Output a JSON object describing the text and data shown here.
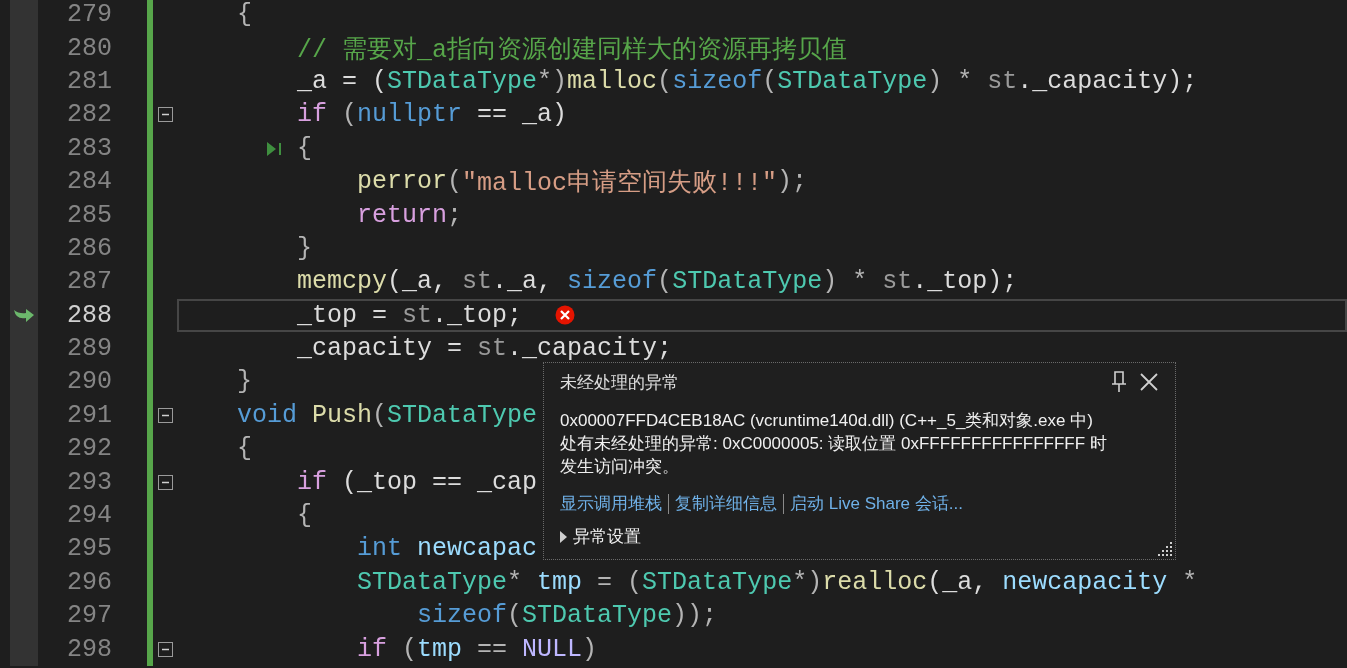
{
  "editor": {
    "lines": [
      {
        "number": "279",
        "tokens": [
          {
            "text": "    {",
            "kind": "punct"
          }
        ]
      },
      {
        "number": "280",
        "tokens": [
          {
            "text": "        // 需要对_a指向资源创建同样大的资源再拷贝值",
            "kind": "comment"
          }
        ]
      },
      {
        "number": "281",
        "tokens": [
          {
            "text": "        _a = (",
            "kind": "plain"
          },
          {
            "text": "STDataType",
            "kind": "type"
          },
          {
            "text": "*)",
            "kind": "punct"
          },
          {
            "text": "malloc",
            "kind": "function"
          },
          {
            "text": "(",
            "kind": "punct"
          },
          {
            "text": "sizeof",
            "kind": "keyword"
          },
          {
            "text": "(",
            "kind": "punct"
          },
          {
            "text": "STDataType",
            "kind": "type"
          },
          {
            "text": ") * ",
            "kind": "punct"
          },
          {
            "text": "st",
            "kind": "param"
          },
          {
            "text": "._capacity);",
            "kind": "plain"
          }
        ]
      },
      {
        "number": "282",
        "fold": true,
        "tokens": [
          {
            "text": "        if",
            "kind": "control"
          },
          {
            "text": " (",
            "kind": "punct"
          },
          {
            "text": "nullptr",
            "kind": "keyword"
          },
          {
            "text": " == _a)",
            "kind": "plain"
          }
        ]
      },
      {
        "number": "283",
        "run_to_cursor": true,
        "tokens": [
          {
            "text": "        {",
            "kind": "punct"
          }
        ]
      },
      {
        "number": "284",
        "tokens": [
          {
            "text": "            perror",
            "kind": "function"
          },
          {
            "text": "(",
            "kind": "punct"
          },
          {
            "text": "\"malloc申请空间失败!!!\"",
            "kind": "string"
          },
          {
            "text": ");",
            "kind": "punct"
          }
        ]
      },
      {
        "number": "285",
        "tokens": [
          {
            "text": "            return",
            "kind": "control"
          },
          {
            "text": ";",
            "kind": "punct"
          }
        ]
      },
      {
        "number": "286",
        "tokens": [
          {
            "text": "        }",
            "kind": "punct"
          }
        ]
      },
      {
        "number": "287",
        "tokens": [
          {
            "text": "        memcpy",
            "kind": "function"
          },
          {
            "text": "(_a, ",
            "kind": "plain"
          },
          {
            "text": "st",
            "kind": "param"
          },
          {
            "text": "._a, ",
            "kind": "plain"
          },
          {
            "text": "sizeof",
            "kind": "keyword"
          },
          {
            "text": "(",
            "kind": "punct"
          },
          {
            "text": "STDataType",
            "kind": "type"
          },
          {
            "text": ") * ",
            "kind": "punct"
          },
          {
            "text": "st",
            "kind": "param"
          },
          {
            "text": "._top);",
            "kind": "plain"
          }
        ]
      },
      {
        "number": "288",
        "current": true,
        "error": true,
        "tokens": [
          {
            "text": "        _top = ",
            "kind": "plain"
          },
          {
            "text": "st",
            "kind": "param"
          },
          {
            "text": "._top;",
            "kind": "plain"
          }
        ]
      },
      {
        "number": "289",
        "tokens": [
          {
            "text": "        _capacity = ",
            "kind": "plain"
          },
          {
            "text": "st",
            "kind": "param"
          },
          {
            "text": "._capacity;",
            "kind": "plain"
          }
        ]
      },
      {
        "number": "290",
        "tokens": [
          {
            "text": "    }",
            "kind": "punct"
          }
        ]
      },
      {
        "number": "291",
        "fold": true,
        "tokens": [
          {
            "text": "    void ",
            "kind": "keyword"
          },
          {
            "text": "Push",
            "kind": "function"
          },
          {
            "text": "(",
            "kind": "punct"
          },
          {
            "text": "STDataType",
            "kind": "type"
          }
        ]
      },
      {
        "number": "292",
        "tokens": [
          {
            "text": "    {",
            "kind": "punct"
          }
        ]
      },
      {
        "number": "293",
        "fold": true,
        "tokens": [
          {
            "text": "        if",
            "kind": "control"
          },
          {
            "text": " (_top == _cap",
            "kind": "plain"
          }
        ]
      },
      {
        "number": "294",
        "tokens": [
          {
            "text": "        {",
            "kind": "punct"
          }
        ]
      },
      {
        "number": "295",
        "tokens": [
          {
            "text": "            int ",
            "kind": "keyword"
          },
          {
            "text": "newcapac",
            "kind": "local"
          }
        ]
      },
      {
        "number": "296",
        "tokens": [
          {
            "text": "            STDataType",
            "kind": "type"
          },
          {
            "text": "* ",
            "kind": "punct"
          },
          {
            "text": "tmp",
            "kind": "local"
          },
          {
            "text": " = (",
            "kind": "punct"
          },
          {
            "text": "STDataType",
            "kind": "type"
          },
          {
            "text": "*)",
            "kind": "punct"
          },
          {
            "text": "realloc",
            "kind": "function"
          },
          {
            "text": "(_a, ",
            "kind": "plain"
          },
          {
            "text": "newcapacity",
            "kind": "local"
          },
          {
            "text": " *",
            "kind": "punct"
          }
        ]
      },
      {
        "number": "297",
        "tokens": [
          {
            "text": "                sizeof",
            "kind": "keyword"
          },
          {
            "text": "(",
            "kind": "punct"
          },
          {
            "text": "STDataType",
            "kind": "type"
          },
          {
            "text": "));",
            "kind": "punct"
          }
        ]
      },
      {
        "number": "298",
        "fold": true,
        "tokens": [
          {
            "text": "            if",
            "kind": "control"
          },
          {
            "text": " (",
            "kind": "punct"
          },
          {
            "text": "tmp",
            "kind": "local"
          },
          {
            "text": " == ",
            "kind": "punct"
          },
          {
            "text": "NULL",
            "kind": "macro"
          },
          {
            "text": ")",
            "kind": "punct"
          }
        ]
      }
    ]
  },
  "exception_popup": {
    "title": "未经处理的异常",
    "message": "0x00007FFD4CEB18AC (vcruntime140d.dll) (C++_5_类和对象.exe 中)处有未经处理的异常: 0xC0000005: 读取位置 0xFFFFFFFFFFFFFFFF 时发生访问冲突。",
    "links": [
      "显示调用堆栈",
      "复制详细信息",
      "启动 Live Share 会话..."
    ],
    "settings": {
      "label": "异常设置",
      "expanded": false
    }
  }
}
